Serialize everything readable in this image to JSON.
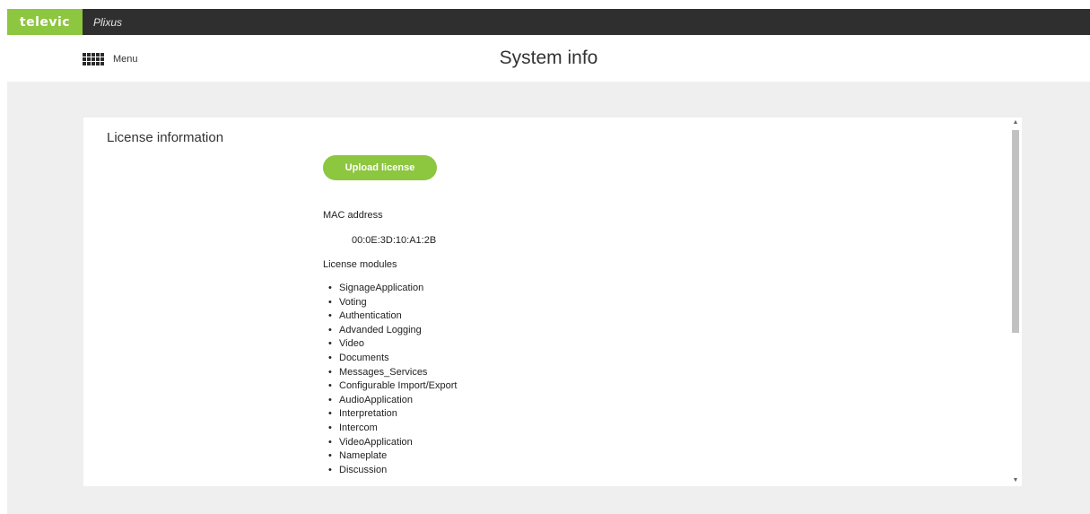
{
  "topbar": {
    "brand": "televic",
    "product": "Plixus"
  },
  "header": {
    "menu_label": "Menu",
    "title": "System info"
  },
  "license": {
    "section_title": "License information",
    "upload_button": "Upload license",
    "mac_label": "MAC address",
    "mac_value": "00:0E:3D:10:A1:2B",
    "modules_label": "License modules",
    "modules": [
      "SignageApplication",
      "Voting",
      "Authentication",
      "Advanded Logging",
      "Video",
      "Documents",
      "Messages_Services",
      "Configurable Import/Export",
      "AudioApplication",
      "Interpretation",
      "Intercom",
      "VideoApplication",
      "Nameplate",
      "Discussion"
    ]
  },
  "icons": {
    "menu": "grid-icon",
    "scroll_up": "scroll-up-arrow-icon",
    "scroll_down": "scroll-down-arrow-icon"
  },
  "colors": {
    "brand_green": "#8dc63f",
    "topbar": "#2f2f2f",
    "content_bg": "#efefef"
  }
}
